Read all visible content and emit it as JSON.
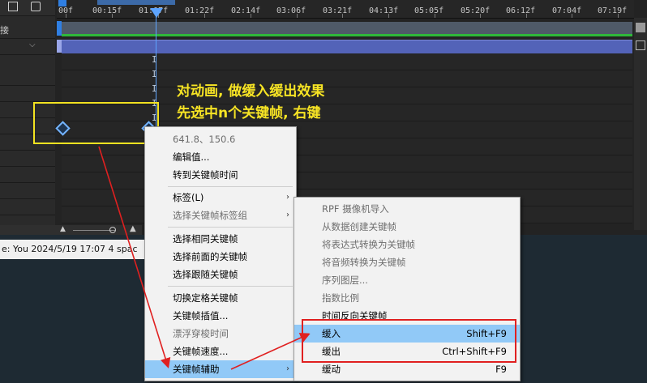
{
  "timeline": {
    "left_labels": [
      "接",
      "",
      ""
    ],
    "ruler_ticks": [
      "00f",
      "00:15f",
      "01:07f",
      "01:22f",
      "02:14f",
      "03:06f",
      "03:21f",
      "04:13f",
      "05:05f",
      "05:20f",
      "06:12f",
      "07:04f",
      "07:19f"
    ],
    "ibeam_glyph": "I"
  },
  "status_bar": {
    "text": "e: You 2024/5/19 17:07   4 spac"
  },
  "annotation": {
    "line1": "对动画, 做缓入缓出效果",
    "line2": "先选中n个关键帧, 右键"
  },
  "context_menu": {
    "items": [
      {
        "label": "641.8、150.6",
        "disabled": true
      },
      {
        "label": "编辑值...",
        "disabled": false
      },
      {
        "label": "转到关键帧时间",
        "disabled": false
      },
      {
        "label": "标签(L)",
        "disabled": false,
        "submenu": true
      },
      {
        "label": "选择关键帧标签组",
        "disabled": true,
        "submenu": true
      },
      {
        "label": "选择相同关键帧",
        "disabled": false
      },
      {
        "label": "选择前面的关键帧",
        "disabled": false
      },
      {
        "label": "选择跟随关键帧",
        "disabled": false
      },
      {
        "label": "切换定格关键帧",
        "disabled": false
      },
      {
        "label": "关键帧插值...",
        "disabled": false
      },
      {
        "label": "漂浮穿梭时间",
        "disabled": true
      },
      {
        "label": "关键帧速度...",
        "disabled": false
      },
      {
        "label": "关键帧辅助",
        "disabled": false,
        "submenu": true,
        "highlighted": true
      }
    ]
  },
  "submenu": {
    "items": [
      {
        "label": "RPF 摄像机导入",
        "shortcut": "",
        "disabled": true
      },
      {
        "label": "从数据创建关键帧",
        "shortcut": "",
        "disabled": true
      },
      {
        "label": "将表达式转换为关键帧",
        "shortcut": "",
        "disabled": true
      },
      {
        "label": "将音频转换为关键帧",
        "shortcut": "",
        "disabled": true
      },
      {
        "label": "序列图层...",
        "shortcut": "",
        "disabled": true
      },
      {
        "label": "指数比例",
        "shortcut": "",
        "disabled": true
      },
      {
        "label": "时间反向关键帧",
        "shortcut": "",
        "disabled": false
      },
      {
        "label": "缓入",
        "shortcut": "Shift+F9",
        "disabled": false,
        "highlighted": true
      },
      {
        "label": "缓出",
        "shortcut": "Ctrl+Shift+F9",
        "disabled": false
      },
      {
        "label": "缓动",
        "shortcut": "F9",
        "disabled": false
      }
    ]
  },
  "submenu_arrow": "›",
  "colors": {
    "annotation": "#f7e424",
    "highlight": "#91c9f7",
    "callout": "#e02020",
    "layer_bar": "#5363b8"
  }
}
